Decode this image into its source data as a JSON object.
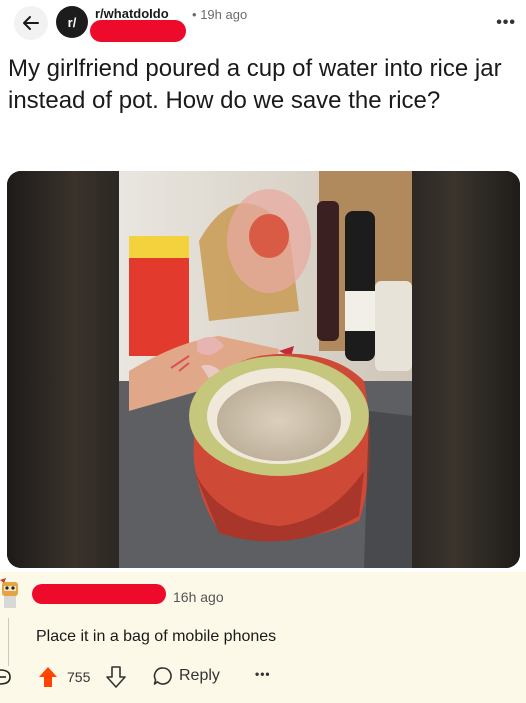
{
  "post": {
    "subreddit": "r/whatdoIdo",
    "subreddit_icon_text": "r/",
    "separator": "•",
    "time": "19h ago",
    "title": "My girlfriend poured a cup of water into rice jar instead of pot. How do we save the rice?",
    "more_icon": "more-horizontal-icon",
    "back_icon": "arrow-left-icon"
  },
  "comment": {
    "time": "16h ago",
    "text": "Place it in a bag of mobile phones",
    "votes": "755",
    "reply_label": "Reply",
    "more_label": "•••"
  },
  "colors": {
    "redaction": "#ee0a2b",
    "upvote": "#ff4500",
    "comment_bg": "#fcf9e8"
  }
}
